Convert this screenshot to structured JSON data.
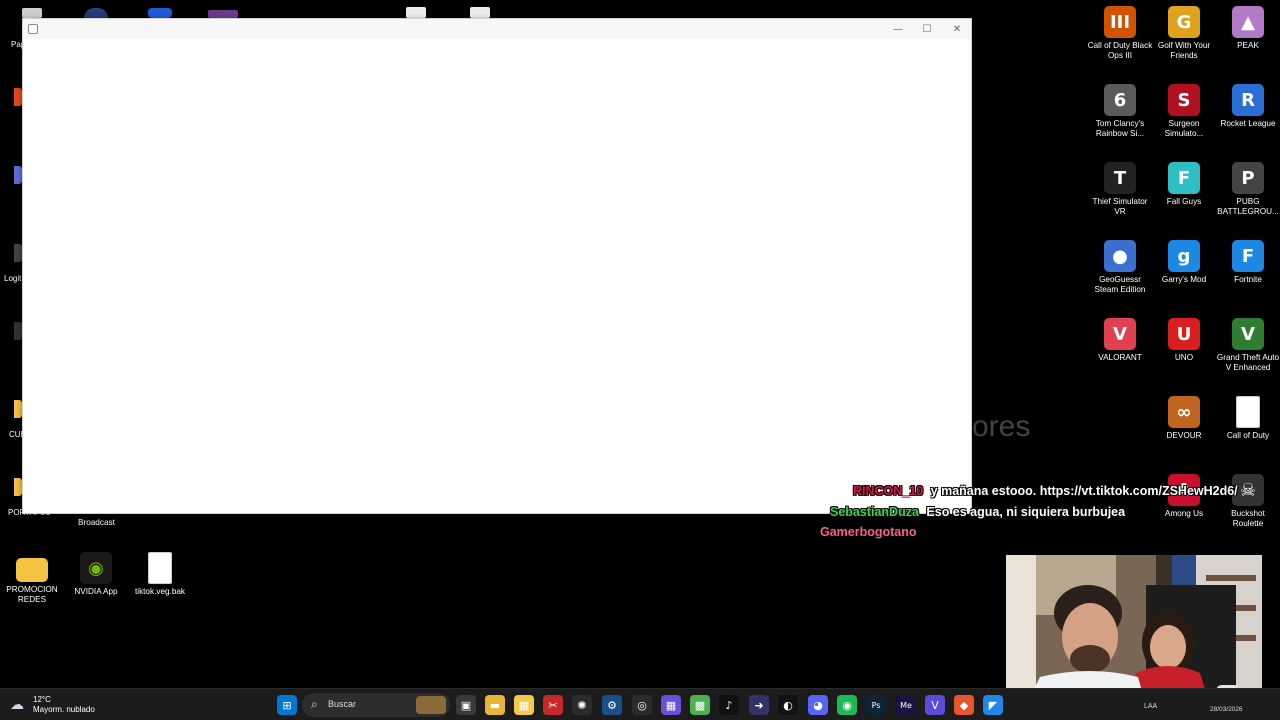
{
  "window": {
    "close_glyph": "✕",
    "maximize_glyph": "☐",
    "minimize_glyph": "—"
  },
  "background_text": "ores",
  "desktop": {
    "right_icons": [
      {
        "label": "Call of Duty Black Ops III",
        "icon": "cod-bo3-icon",
        "glyph": "III",
        "color": "#d35400"
      },
      {
        "label": "Golf With Your Friends",
        "icon": "golf-icon",
        "glyph": "G",
        "color": "#e0a21b"
      },
      {
        "label": "PEAK",
        "icon": "peak-icon",
        "glyph": "▲",
        "color": "#b07ac9"
      },
      {
        "label": "Tom Clancy's Rainbow Si...",
        "icon": "rainbow-six-icon",
        "glyph": "6",
        "color": "#5a5a5a"
      },
      {
        "label": "Surgeon Simulato...",
        "icon": "surgeon-icon",
        "glyph": "S",
        "color": "#b01020"
      },
      {
        "label": "Rocket League",
        "icon": "rocket-league-icon",
        "glyph": "R",
        "color": "#2a6fd6"
      },
      {
        "label": "Thief Simulator VR",
        "icon": "thief-icon",
        "glyph": "T",
        "color": "#222222"
      },
      {
        "label": "Fall Guys",
        "icon": "fall-guys-icon",
        "glyph": "F",
        "color": "#2dbfc4"
      },
      {
        "label": "PUBG BATTLEGROU...",
        "icon": "pubg-icon",
        "glyph": "P",
        "color": "#444444"
      },
      {
        "label": "GeoGuessr Steam Edition",
        "icon": "geoguessr-icon",
        "glyph": "●",
        "color": "#3b6fd0"
      },
      {
        "label": "Garry's Mod",
        "icon": "garrys-mod-icon",
        "glyph": "g",
        "color": "#1e88e5"
      },
      {
        "label": "Fortnite",
        "icon": "fortnite-icon",
        "glyph": "F",
        "color": "#1e88e5"
      },
      {
        "label": "VALORANT",
        "icon": "valorant-icon",
        "glyph": "V",
        "color": "#e04050"
      },
      {
        "label": "UNO",
        "icon": "uno-icon",
        "glyph": "U",
        "color": "#d81e1e"
      },
      {
        "label": "Grand Theft Auto V Enhanced",
        "icon": "gta-icon",
        "glyph": "V",
        "color": "#2e7d32"
      },
      {
        "label": "DEVOUR",
        "icon": "devour-icon",
        "glyph": "∞",
        "color": "#c0651f"
      },
      {
        "label": "Call of Duty",
        "icon": "file-icon",
        "glyph": "",
        "color": "#ffffff"
      },
      {
        "label": "Among Us",
        "icon": "among-us-icon",
        "glyph": "A",
        "color": "#c8102e"
      },
      {
        "label": "Buckshot Roulette",
        "icon": "buckshot-icon",
        "glyph": "☠",
        "color": "#333333"
      }
    ],
    "bottom_icons": [
      {
        "label": "PROMOCION REDES",
        "icon": "folder-icon",
        "glyph": "",
        "color": "#f5c242"
      },
      {
        "label": "NVIDIA App",
        "icon": "nvidia-icon",
        "glyph": "◉",
        "color": "#1a1a1a"
      },
      {
        "label": "tiktok.veg.bak",
        "icon": "file-icon",
        "glyph": "",
        "color": "#ffffff"
      }
    ],
    "partial_labels": {
      "broadcast": "Broadcast",
      "left_1": "Pap",
      "left_2": "Logit",
      "left_3": "CUE",
      "left_4": "PORTAFOL"
    }
  },
  "chat": [
    {
      "user": "RINCON_10",
      "message": "y mañana estooo. https://vt.tiktok.com/ZSHewH2d6/"
    },
    {
      "user": "SebastianDuza",
      "message": "Eso es agua, ni siquiera burbujea"
    },
    {
      "user": "Gamerbogotano",
      "message": ""
    }
  ],
  "taskbar": {
    "weather_temp": "12°C",
    "weather_desc": "Mayorm. nublado",
    "search_label": "Buscar",
    "language": "LAA",
    "date": "28/03/2026",
    "apps": [
      {
        "name": "start-icon",
        "glyph": "⊞",
        "color": "#0078d4"
      },
      {
        "name": "task-view-icon",
        "glyph": "▣",
        "color": "#3a3a3a"
      },
      {
        "name": "file-explorer-icon",
        "glyph": "▬",
        "color": "#e8b634"
      },
      {
        "name": "microsoft-store-icon",
        "glyph": "▦",
        "color": "#f2c94c"
      },
      {
        "name": "snipping-tool-icon",
        "glyph": "✂",
        "color": "#c62828"
      },
      {
        "name": "chatgpt-icon",
        "glyph": "✺",
        "color": "#2b2b2b"
      },
      {
        "name": "steam-icon",
        "glyph": "⚙",
        "color": "#1b4f8a"
      },
      {
        "name": "chrome-icon",
        "glyph": "◎",
        "color": "#2b2b2b"
      },
      {
        "name": "grid-app-icon",
        "glyph": "▦",
        "color": "#6b4fd8"
      },
      {
        "name": "minecraft-icon",
        "glyph": "▩",
        "color": "#4caf50"
      },
      {
        "name": "tiktok-icon",
        "glyph": "♪",
        "color": "#111111"
      },
      {
        "name": "app-arrow-icon",
        "glyph": "➜",
        "color": "#333366"
      },
      {
        "name": "capcut-icon",
        "glyph": "◐",
        "color": "#111111"
      },
      {
        "name": "discord-icon",
        "glyph": "◕",
        "color": "#5865f2"
      },
      {
        "name": "spotify-icon",
        "glyph": "◉",
        "color": "#1db954"
      },
      {
        "name": "photoshop-icon",
        "glyph": "Ps",
        "color": "#0d2338"
      },
      {
        "name": "media-encoder-icon",
        "glyph": "Me",
        "color": "#1b1340"
      },
      {
        "name": "vegas-icon",
        "glyph": "V",
        "color": "#5c4bd6"
      },
      {
        "name": "brave-icon",
        "glyph": "◆",
        "color": "#e8552d"
      },
      {
        "name": "vscode-icon",
        "glyph": "◤",
        "color": "#1e88e5"
      }
    ]
  }
}
